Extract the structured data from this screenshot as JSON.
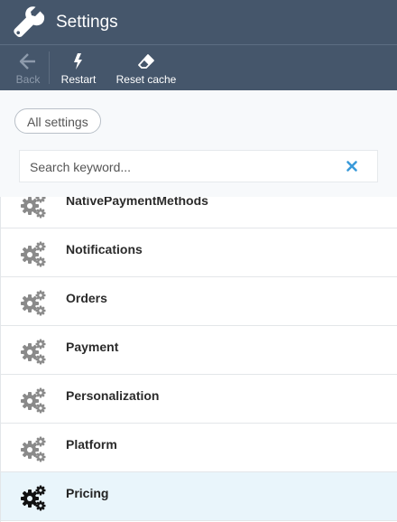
{
  "header": {
    "title": "Settings",
    "icon": "wrench-icon"
  },
  "toolbar": {
    "back_label": "Back",
    "restart_label": "Restart",
    "reset_cache_label": "Reset cache"
  },
  "filter": {
    "all_settings_label": "All settings",
    "search_placeholder": "Search keyword..."
  },
  "settings_list": {
    "items": [
      {
        "label": "NativePaymentMethods",
        "selected": false
      },
      {
        "label": "Notifications",
        "selected": false
      },
      {
        "label": "Orders",
        "selected": false
      },
      {
        "label": "Payment",
        "selected": false
      },
      {
        "label": "Personalization",
        "selected": false
      },
      {
        "label": "Platform",
        "selected": false
      },
      {
        "label": "Pricing",
        "selected": true
      }
    ]
  },
  "colors": {
    "header_bg": "#45566b",
    "selected_row_bg": "#e9f5fb",
    "clear_icon": "#3a9ad9",
    "gear_inactive": "#8a8a8a",
    "gear_active": "#111111"
  }
}
